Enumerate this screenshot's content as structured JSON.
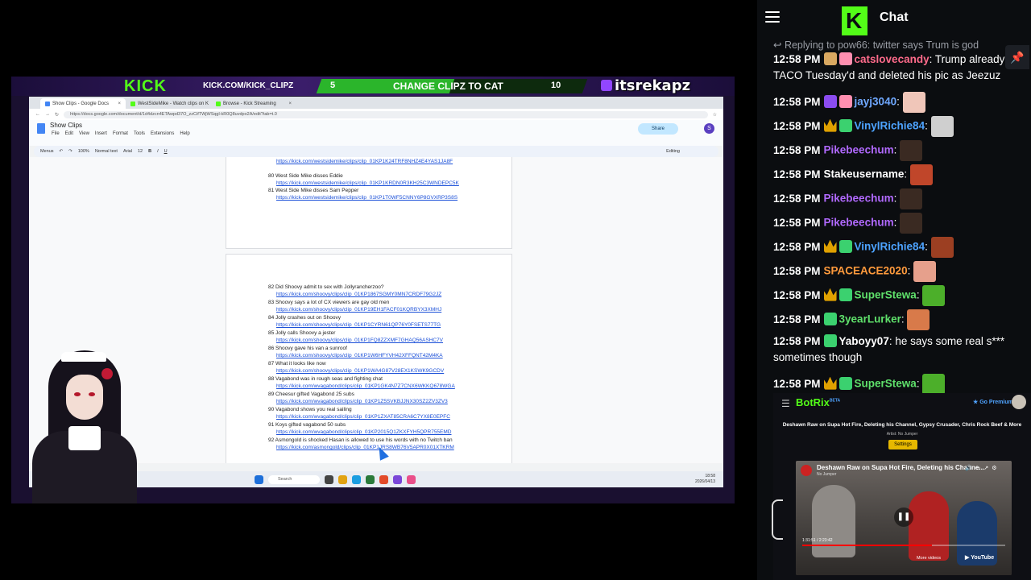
{
  "overlay": {
    "logo": "KICK",
    "url": "KICK.COM/KICK_CLIPZ",
    "goal_current": "5",
    "goal_text": "CHANGE CLIPZ TO CAT",
    "goal_target": "10",
    "goal_progress": 0.5,
    "handle": "itsrekapz"
  },
  "browser": {
    "tabs": [
      {
        "label": "Show Clips - Google Docs",
        "color": "#4285f4"
      },
      {
        "label": "WestSideMike - Watch clips on K",
        "color": "#53fc18"
      },
      {
        "label": "Browse - Kick Streaming",
        "color": "#53fc18"
      }
    ],
    "url": "https://docs.google.com/document/d/1d4dzcn4ETAwpd37O_zzCifTWjWSqgl-kR0Q8uvdpo2A/edit?tab=t.0",
    "doc_title": "Show Clips",
    "menus": [
      "File",
      "Edit",
      "View",
      "Insert",
      "Format",
      "Tools",
      "Extensions",
      "Help"
    ],
    "share_label": "Share",
    "avatar_letter": "S",
    "toolbar": {
      "menus_label": "Menus",
      "zoom": "100%",
      "style": "Normal text",
      "font": "Arial",
      "size": "12",
      "mode": "Editing"
    },
    "page1_entries": [
      {
        "text": "",
        "link": "https://kick.com/westsidemike/clips/clip_01KP1K24TRF8NHZ4E4YAS1JA8F"
      },
      {
        "text": "80 West Side Mike disses Eddie",
        "link": "https://kick.com/westsidemike/clips/clip_01KP1KRDN0R3KH25C3WNDEPC5K"
      },
      {
        "text": "81 West Side Mike disses Sam Pepper",
        "link": "https://kick.com/westsidemike/clips/clip_01KP1T0WF5CNNY6P8GVXRP3S8S"
      }
    ],
    "page2_entries": [
      {
        "text": "82 Did Shoovy admit to sex with Jollyrancherzoo?",
        "link": "https://kick.com/shoovy/clips/clip_01KP1867SGMY0MN7CRDF79G2JZ"
      },
      {
        "text": "83 Shoovy says a lot of CX viewers are gay old men",
        "link": "https://kick.com/shoovy/clips/clip_01KP19EH1FACF01KQRBYX3XMHJ"
      },
      {
        "text": "84 Jolly crashes out on Shoovy",
        "link": "https://kick.com/shoovy/clips/clip_01KP1CYRN61QP76Y0FSETS77TG"
      },
      {
        "text": "85 Jolly calls Shoovy a jester",
        "link": "https://kick.com/shoovy/clips/clip_01KP1FQ8ZZXMF7GHAQ56ASHC7V"
      },
      {
        "text": "86 Shoovy gave his van a sunroof",
        "link": "https://kick.com/shoovy/clips/clip_01KP1W6HFYVH42XFFQNT42M4KA"
      },
      {
        "text": "87 What it looks like now",
        "link": "https://kick.com/shoovy/clips/clip_01KP1WA4G87V28EX1KSWK9GCDV"
      },
      {
        "text": "88 Vagabond was in rough seas and fighting chat",
        "link": "https://kick.com/wvagabond/clips/clip_01KP1GK4N7Z7CNX6WKKQ678WGA"
      },
      {
        "text": "89 Cheesur gifted Vagabond 25 subs",
        "link": "https://kick.com/wvagabond/clips/clip_01KP1Z5SVKBJJNX30SZ2ZV3ZV3"
      },
      {
        "text": "90 Vagabond shows you real sailing",
        "link": "https://kick.com/wvagabond/clips/clip_01KP1ZXAT85CRA6C7YX8E0EPFC"
      },
      {
        "text": "91 Koys gifted vagabond 50 subs",
        "link": "https://kick.com/wvagabond/clips/clip_01KP2015Q1ZKXFYH5QPR755EMD"
      },
      {
        "text": "92 Asmongold is shocked Hasan is allowed to use his words with no Twitch ban",
        "link": "https://kick.com/asmongold/clips/clip_01KP1JRS8WB76V5APR0X01XTKRM"
      }
    ],
    "taskbar_search": "Search",
    "clock": "18:58",
    "date": "2026/04/13"
  },
  "chat": {
    "title": "Chat",
    "reply_text": "Replying to pow66: twitter says Trum is god",
    "pin_icon": "pin-icon",
    "messages": [
      {
        "time": "12:58 PM",
        "badges": [
          "tan",
          "gift"
        ],
        "user": "catslovecandy",
        "color": "#ff6b8b",
        "text": "Trump already TACO Tuesday'd and deleted his pic as Jeezuz",
        "emote": ""
      },
      {
        "time": "12:58 PM",
        "badges": [
          "purple",
          "gift"
        ],
        "user": "jayj3040",
        "color": "#6fa8ff",
        "text": "",
        "emote": "#f0c6b9"
      },
      {
        "time": "12:58 PM",
        "badges": [
          "crown",
          "green"
        ],
        "user": "VinylRichie84",
        "color": "#4da3ff",
        "text": "",
        "emote": "#cfcfcf"
      },
      {
        "time": "12:58 PM",
        "badges": [],
        "user": "Pikebeechum",
        "color": "#b169ff",
        "text": "",
        "emote": "#3a2a22"
      },
      {
        "time": "12:58 PM",
        "badges": [],
        "user": "Stakeusername",
        "color": "#ffffff",
        "text": "",
        "emote": "#c0462a"
      },
      {
        "time": "12:58 PM",
        "badges": [],
        "user": "Pikebeechum",
        "color": "#b169ff",
        "text": "",
        "emote": "#3a2a22"
      },
      {
        "time": "12:58 PM",
        "badges": [],
        "user": "Pikebeechum",
        "color": "#b169ff",
        "text": "",
        "emote": "#3a2a22"
      },
      {
        "time": "12:58 PM",
        "badges": [
          "crown",
          "green"
        ],
        "user": "VinylRichie84",
        "color": "#4da3ff",
        "text": "",
        "emote": "#9c3f22"
      },
      {
        "time": "12:58 PM",
        "badges": [],
        "user": "SPACEACE2020",
        "color": "#ff9a3c",
        "text": "",
        "emote": "#e6a08c"
      },
      {
        "time": "12:58 PM",
        "badges": [
          "crown",
          "green"
        ],
        "user": "SuperStewa",
        "color": "#5fe06b",
        "text": "",
        "emote": "#4caf2a"
      },
      {
        "time": "12:58 PM",
        "badges": [
          "green"
        ],
        "user": "3yearLurker",
        "color": "#5fe06b",
        "text": "",
        "emote": "#d87a4a"
      },
      {
        "time": "12:58 PM",
        "badges": [
          "green"
        ],
        "user": "Yaboyy07",
        "color": "#ffffff",
        "text": "he says some real s*** sometimes though",
        "emote": ""
      },
      {
        "time": "12:58 PM",
        "badges": [
          "crown",
          "green"
        ],
        "user": "SuperStewa",
        "color": "#5fe06b",
        "text": "",
        "emote": "#4caf2a"
      }
    ]
  },
  "botrix": {
    "title": "BotRix",
    "beta": "BETA",
    "go_premium": "Go Premium",
    "now_playing": "Deshawn Raw on Supa Hot Fire, Deleting his Channel, Gypsy Crusader, Chris Rock Beef & More",
    "artist_label": "Artist:",
    "artist": "No Jumper",
    "settings_label": "Settings",
    "video_title": "Deshawn Raw on Supa Hot Fire, Deleting his Channe...",
    "video_channel": "No Jumper",
    "video_time": "1:31:51 / 2:23:42",
    "video_progress": 0.64,
    "more_videos": "More videos",
    "youtube": "YouTube"
  }
}
